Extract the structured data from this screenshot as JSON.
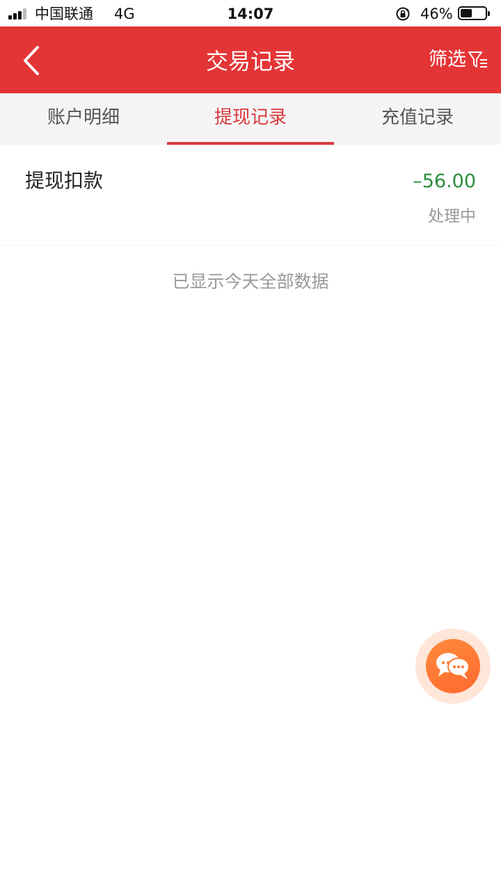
{
  "status_bar": {
    "carrier": "中国联通",
    "network": "4G",
    "time": "14:07",
    "battery_percent_text": "46%",
    "battery_level": 0.46
  },
  "nav": {
    "back_icon": "chevron-left-icon",
    "title": "交易记录",
    "filter_label": "筛选",
    "filter_icon": "filter-icon",
    "background_color": "#e43536"
  },
  "tabs": [
    {
      "label": "账户明细",
      "active": false
    },
    {
      "label": "提现记录",
      "active": true
    },
    {
      "label": "充值记录",
      "active": false
    }
  ],
  "records": [
    {
      "title": "提现扣款",
      "amount": "–56.00",
      "status": "处理中"
    }
  ],
  "footer_note": "已显示今天全部数据",
  "chat_button": {
    "icon": "chat-bubbles-icon",
    "color": "#ff7a35"
  },
  "colors": {
    "accent": "#d8393c",
    "amount_negative": "#2a8f3c"
  }
}
